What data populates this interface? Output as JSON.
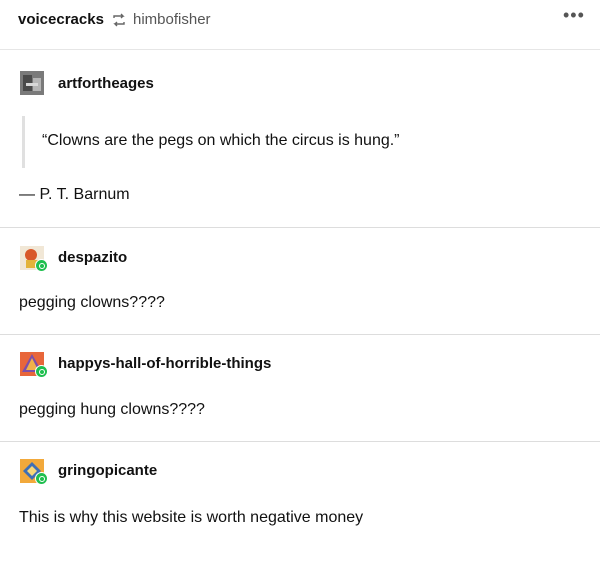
{
  "header": {
    "reblogger": "voicecracks",
    "source": "himbofisher",
    "more_label": "•••"
  },
  "posts": [
    {
      "username": "artfortheages",
      "quote": "“Clowns are the pegs on which the circus is hung.”",
      "attribution": "— P. T. Barnum"
    },
    {
      "username": "despazito",
      "body": "pegging clowns????"
    },
    {
      "username": "happys-hall-of-horrible-things",
      "body": "pegging hung clowns????"
    },
    {
      "username": "gringopicante",
      "body": "This is why this website is worth negative money"
    }
  ]
}
